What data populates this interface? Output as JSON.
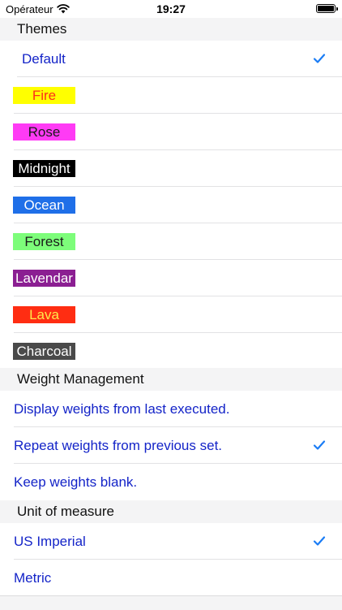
{
  "status_bar": {
    "carrier": "Opérateur",
    "time": "19:27"
  },
  "sections": {
    "themes": {
      "title": "Themes"
    },
    "weight": {
      "title": "Weight Management"
    },
    "unit": {
      "title": "Unit of measure"
    }
  },
  "themes": [
    {
      "label": "Default",
      "selected": true
    },
    {
      "label": "Fire",
      "bg": "#ffff00",
      "fg": "#ff2d1a",
      "selected": false
    },
    {
      "label": "Rose",
      "bg": "#ff3bf5",
      "fg": "#1a1a1a",
      "selected": false
    },
    {
      "label": "Midnight",
      "bg": "#000000",
      "fg": "#ffffff",
      "selected": false
    },
    {
      "label": "Ocean",
      "bg": "#1f6fe8",
      "fg": "#ffffff",
      "selected": false
    },
    {
      "label": "Forest",
      "bg": "#7dfd7a",
      "fg": "#1a1a1a",
      "selected": false
    },
    {
      "label": "Lavendar",
      "bg": "#8b1f92",
      "fg": "#ffffff",
      "selected": false
    },
    {
      "label": "Lava",
      "bg": "#ff2d12",
      "fg": "#ffe94a",
      "selected": false
    },
    {
      "label": "Charcoal",
      "bg": "#4a4a4a",
      "fg": "#ffffff",
      "selected": false
    }
  ],
  "weight_options": [
    {
      "label": "Display weights from last executed.",
      "selected": false
    },
    {
      "label": "Repeat weights from previous set.",
      "selected": true
    },
    {
      "label": "Keep weights blank.",
      "selected": false
    }
  ],
  "unit_options": [
    {
      "label": "US Imperial",
      "selected": true
    },
    {
      "label": "Metric",
      "selected": false
    }
  ],
  "colors": {
    "link": "#1424c8",
    "checkmark": "#1a7cf5",
    "section_bg": "#f4f4f5"
  }
}
